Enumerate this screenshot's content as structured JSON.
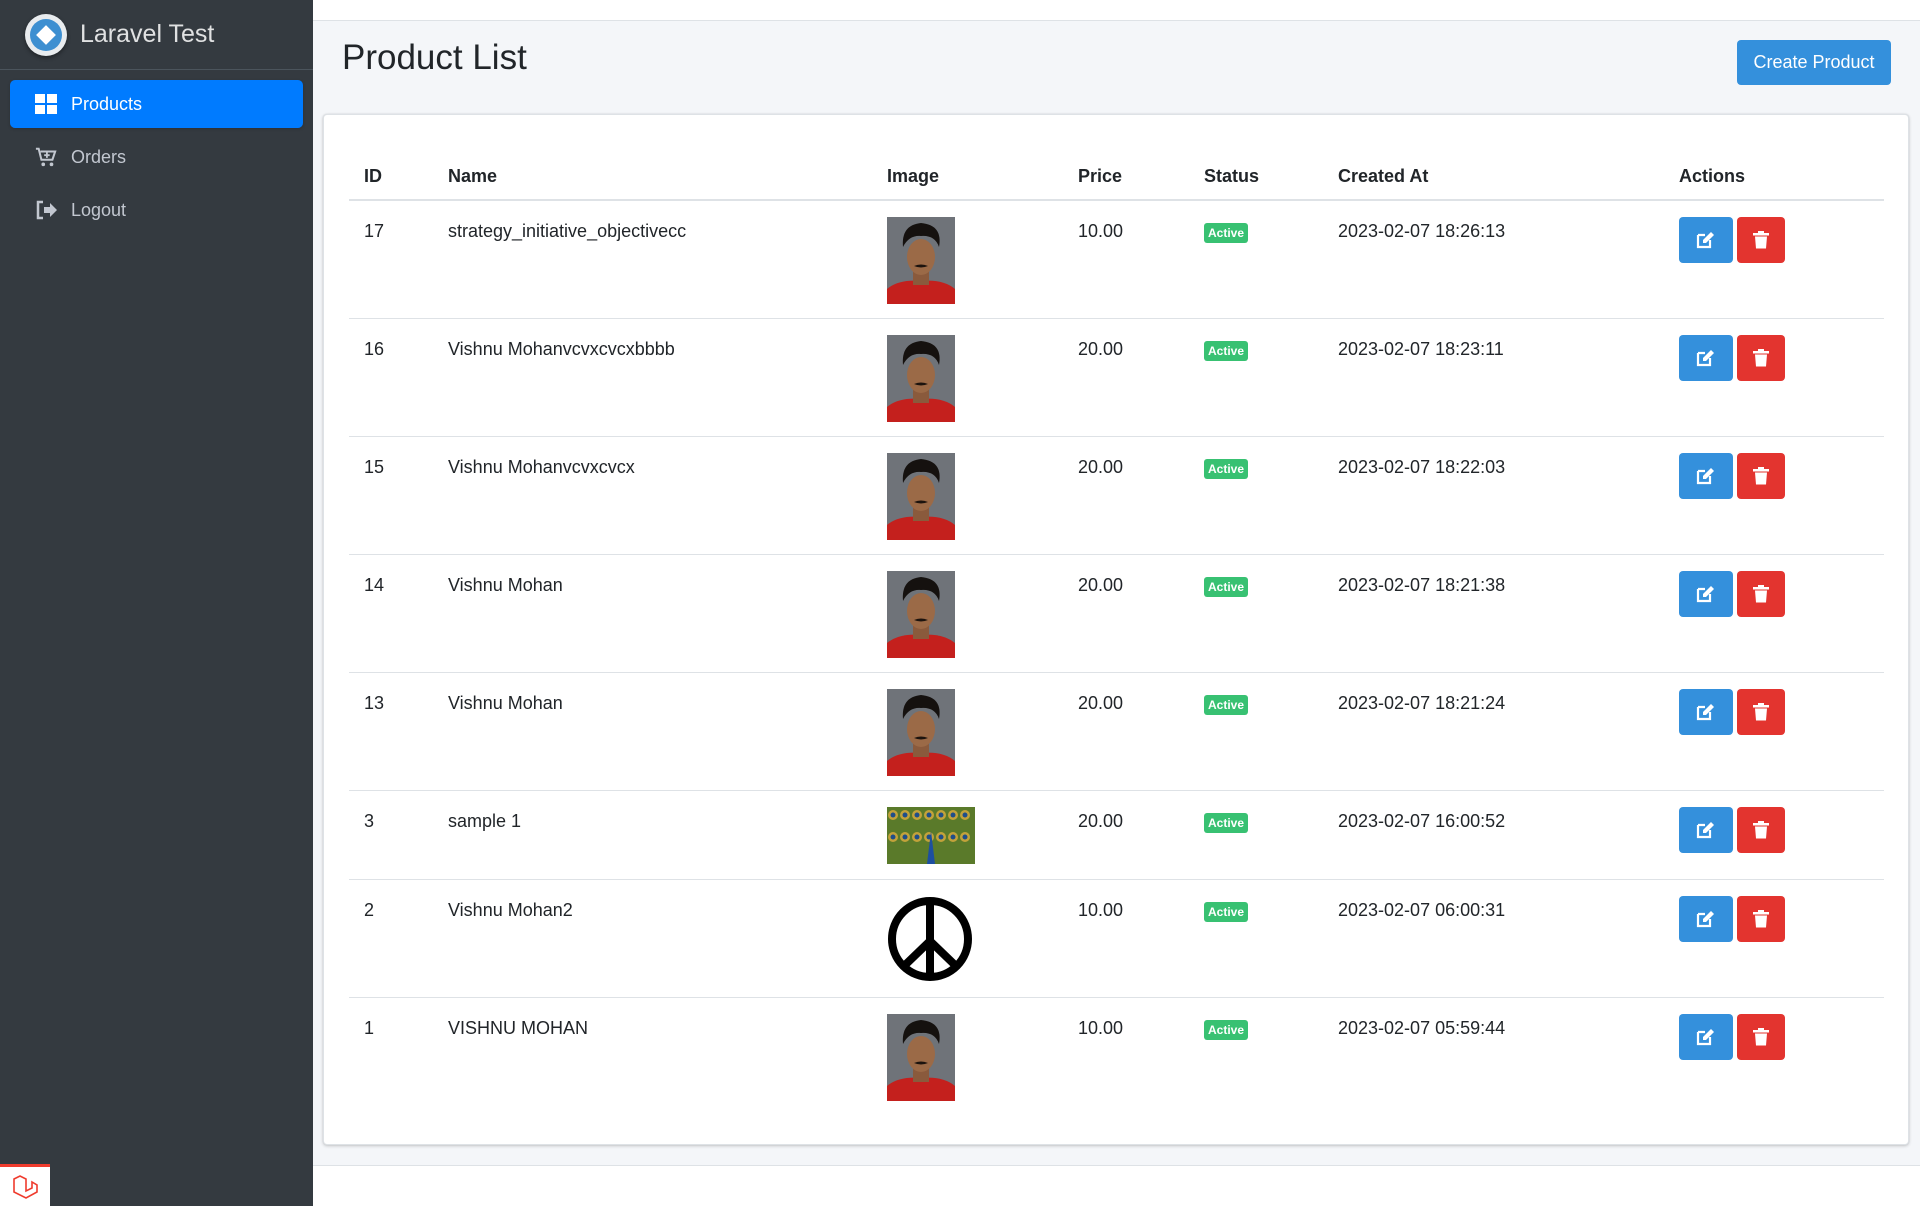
{
  "brand": {
    "name": "Laravel Test"
  },
  "sidebar": {
    "items": [
      {
        "label": "Products",
        "icon": "grid-icon",
        "active": true
      },
      {
        "label": "Orders",
        "icon": "cart-plus-icon",
        "active": false
      },
      {
        "label": "Logout",
        "icon": "sign-out-icon",
        "active": false
      }
    ]
  },
  "page": {
    "title": "Product List",
    "create_label": "Create Product"
  },
  "table": {
    "headers": [
      "ID",
      "Name",
      "Image",
      "Price",
      "Status",
      "Created At",
      "Actions"
    ],
    "rows": [
      {
        "id": "17",
        "name": "strategy_initiative_objectivecc",
        "image": "portrait",
        "price": "10.00",
        "status": "Active",
        "created_at": "2023-02-07 18:26:13"
      },
      {
        "id": "16",
        "name": "Vishnu Mohanvcvxcvcxbbbb",
        "image": "portrait",
        "price": "20.00",
        "status": "Active",
        "created_at": "2023-02-07 18:23:11"
      },
      {
        "id": "15",
        "name": "Vishnu Mohanvcvxcvcx",
        "image": "portrait",
        "price": "20.00",
        "status": "Active",
        "created_at": "2023-02-07 18:22:03"
      },
      {
        "id": "14",
        "name": "Vishnu Mohan",
        "image": "portrait",
        "price": "20.00",
        "status": "Active",
        "created_at": "2023-02-07 18:21:38"
      },
      {
        "id": "13",
        "name": "Vishnu Mohan",
        "image": "portrait",
        "price": "20.00",
        "status": "Active",
        "created_at": "2023-02-07 18:21:24"
      },
      {
        "id": "3",
        "name": "sample 1",
        "image": "peacock",
        "price": "20.00",
        "status": "Active",
        "created_at": "2023-02-07 16:00:52"
      },
      {
        "id": "2",
        "name": "Vishnu Mohan2",
        "image": "peace-symbol",
        "price": "10.00",
        "status": "Active",
        "created_at": "2023-02-07 06:00:31"
      },
      {
        "id": "1",
        "name": "VISHNU MOHAN",
        "image": "portrait",
        "price": "10.00",
        "status": "Active",
        "created_at": "2023-02-07 05:59:44"
      }
    ]
  },
  "colors": {
    "primary": "#3490dc",
    "danger": "#e3342f",
    "success": "#38c172",
    "sidebar": "#343a40",
    "nav_active": "#007bff"
  }
}
